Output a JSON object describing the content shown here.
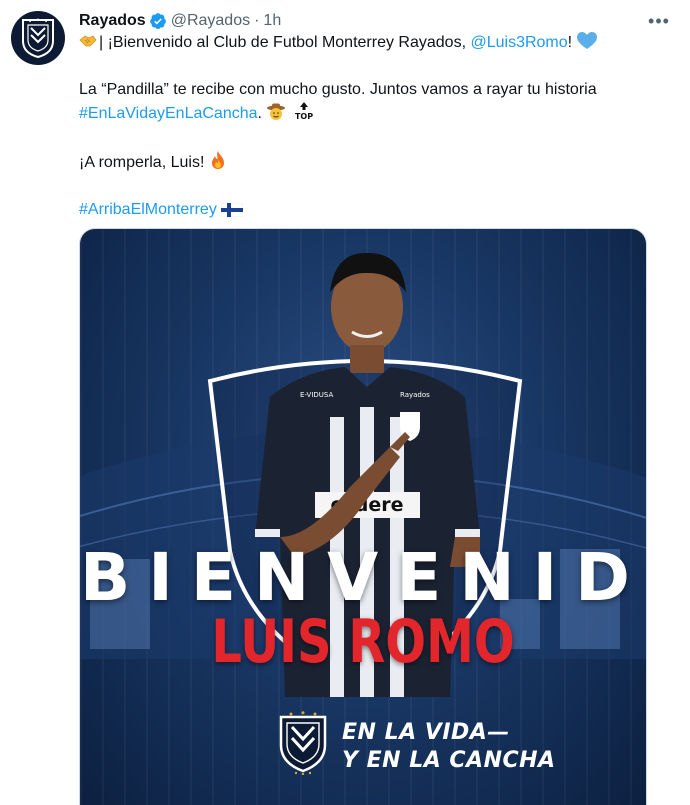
{
  "tweet": {
    "display_name": "Rayados",
    "handle": "@Rayados",
    "separator": "·",
    "time": "1h",
    "more_label": "•••",
    "paragraphs": {
      "p1": {
        "prefix": "| ¡Bienvenido al Club de Futbol Monterrey Rayados, ",
        "mention": "@Luis3Romo",
        "suffix": "!"
      },
      "p2": {
        "line1": "La “Pandilla” te recibe con mucho gusto. Juntos vamos a rayar tu historia",
        "hashtag": "#EnLaVidayEnLaCancha",
        "after": "."
      },
      "p3": "¡A romperla, Luis!",
      "p4_hashtag": "#ArribaElMonterrey"
    },
    "icons": {
      "p1_lead": "handshake-icon",
      "p1_end": "blue-heart-icon",
      "p2_end1": "cowboy-face-icon",
      "p2_end2": "top-arrow-icon",
      "p3_end": "fire-icon",
      "p4_end": "finland-flag-icon",
      "verified": "verified-badge-icon"
    }
  },
  "media": {
    "headline": "BIENVENIDO",
    "player_name": "LUIS ROMO",
    "slogan_line1": "EN LA VIDA—",
    "slogan_line2": "Y EN LA CANCHA",
    "jersey_sponsor": "codere",
    "jersey_left": "E-VIDUSA",
    "jersey_right": "Rayados"
  },
  "colors": {
    "link": "#1d9bf0",
    "secondary_text": "#536471",
    "verified": "#1d9bf0",
    "headline": "#ffffff",
    "player_name": "#e3262c"
  }
}
